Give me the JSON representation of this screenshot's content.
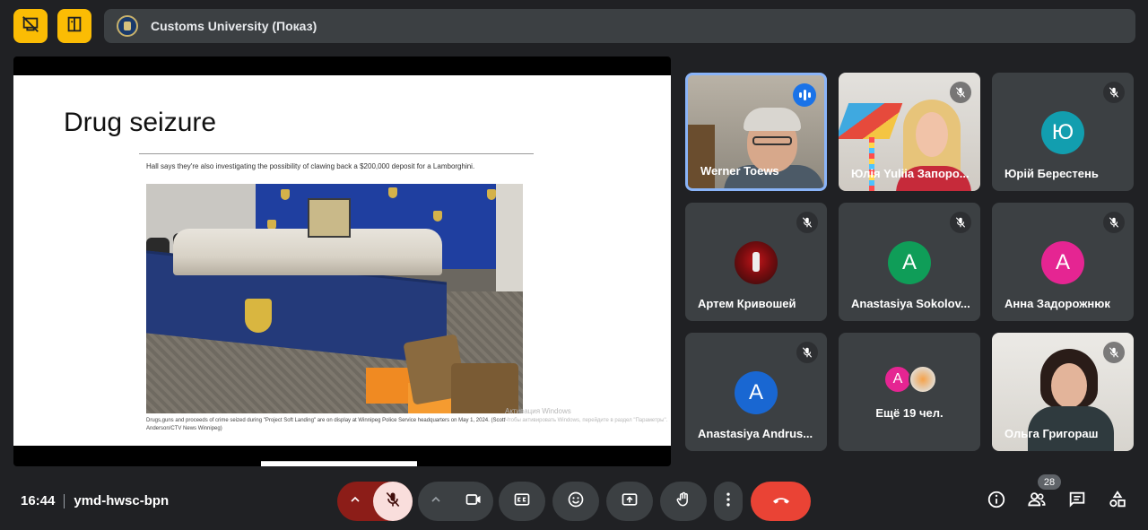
{
  "meeting": {
    "presenter_title": "Customs University (Показ)",
    "time": "16:44",
    "code": "ymd-hwsc-bpn",
    "participant_count": "28"
  },
  "slide": {
    "title": "Drug seizure",
    "quote": "Hall says they're also investigating the possibility of clawing back a $200,000 deposit for a Lamborghini.",
    "caption": "Drugs,guns and proceeds of crime seized during \"Project Soft Landing\" are on display at Winnipeg Police Service headquarters on May 1, 2024. (Scott Anderson/CTV News Winnipeg)",
    "activation_title": "Активация Windows",
    "activation_sub": "Чтобы активировать Windows, перейдите в раздел \"Параметры\"."
  },
  "participants": [
    {
      "name": "Werner Toews",
      "speaking": true
    },
    {
      "name": "Юлія Yuliia Запоро...",
      "muted": true
    },
    {
      "name": "Юрій Берестень",
      "initial": "Ю",
      "avatar_color": "#129eaf",
      "muted": true
    },
    {
      "name": "Артем Кривошей",
      "muted": true
    },
    {
      "name": "Anastasiya Sokolov...",
      "initial": "A",
      "avatar_color": "#0f9d58",
      "muted": true
    },
    {
      "name": "Анна Задорожнюк",
      "initial": "A",
      "avatar_color": "#e52592",
      "muted": true
    },
    {
      "name": "Anastasiya Andrus...",
      "initial": "A",
      "avatar_color": "#1967d2",
      "muted": true
    },
    {
      "name": "Ольга Григораш",
      "muted": true
    }
  ],
  "more": {
    "label": "Ещё 19 чел.",
    "initial": "A",
    "avatar_color": "#e52592"
  },
  "colors": {
    "accent_yellow": "#fbbc04",
    "end_call_red": "#ea4335",
    "mic_off_bg": "#f9dedc",
    "mic_off_arrow_bg": "#8c1d18",
    "speaking_blue": "#1a73e8"
  },
  "icons": {
    "top_left_1": "stop-presenting-icon",
    "top_left_2": "present-view-icon",
    "controls": [
      "chevron-up-icon",
      "mic-off-icon",
      "chevron-up-icon",
      "camera-icon",
      "captions-icon",
      "emoji-icon",
      "present-screen-icon",
      "raise-hand-icon",
      "more-options-icon",
      "end-call-icon"
    ],
    "side": [
      "info-icon",
      "people-icon",
      "chat-icon",
      "activities-icon"
    ]
  }
}
